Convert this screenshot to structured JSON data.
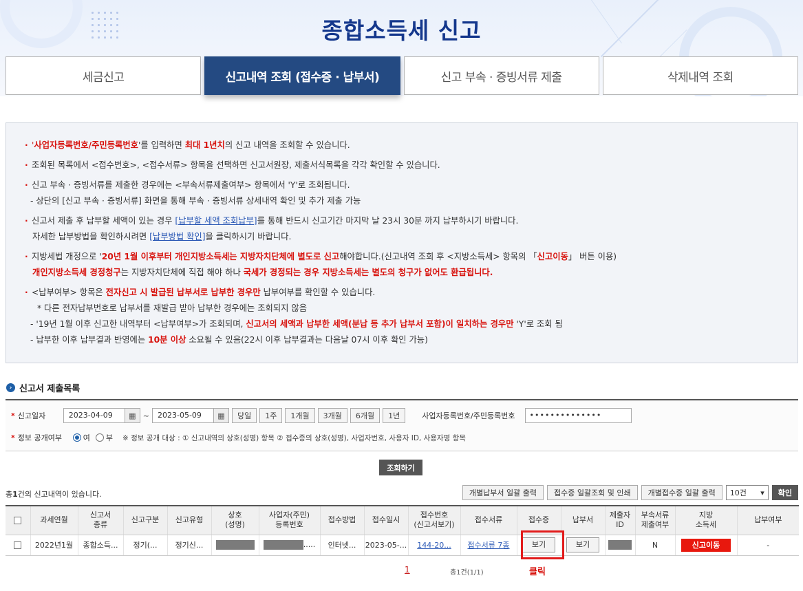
{
  "header": {
    "title": "종합소득세  신고"
  },
  "tabs": [
    {
      "label": "세금신고"
    },
    {
      "label": "신고내역 조회 (접수증 · 납부서)"
    },
    {
      "label": "신고 부속 · 증빙서류 제출"
    },
    {
      "label": "삭제내역 조회"
    }
  ],
  "notice": {
    "l1a": "'",
    "l1b": "사업자등록번호/주민등록번호",
    "l1c": "'를 입력하면 ",
    "l1d": "최대 1년치",
    "l1e": "의 신고 내역을 조회할 수 있습니다.",
    "l2": "조회된 목록에서 <접수번호>, <접수서류> 항목을 선택하면 신고서원장, 제출서식목록을 각각 확인할 수 있습니다.",
    "l3": "신고 부속 · 증빙서류를 제출한 경우에는 <부속서류제출여부> 항목에서 'Y'로 조회됩니다.",
    "l4": "- 상단의 [신고 부속 · 증빙서류] 화면을 통해 부속 · 증빙서류 상세내역 확인 및 추가 제출 가능",
    "l5a": "신고서 제출 후 납부할 세액이 있는 경우 ",
    "l5b": "[납부할 세액 조회납부]",
    "l5c": "를 통해 반드시 신고기간 마지막 날 23시 30분 까지 납부하시기 바랍니다.",
    "l6a": "자세한 납부방법을 확인하시려면 ",
    "l6b": "[납부방법 확인]",
    "l6c": "을 클릭하시기 바랍니다.",
    "l7a": "지방세법 개정으로 '",
    "l7b": "20년 1월 이후부터 개인지방소득세는 지방자치단체에 별도로 신고",
    "l7c": "해야합니다.(신고내역 조회 후 <지방소득세> 항목의 「",
    "l7d": "신고이동",
    "l7e": "」 버튼 이용)",
    "l8a": "개인지방소득세 경정청구",
    "l8b": "는 지방자치단체에 직접 해야 하나 ",
    "l8c": "국세가 경정되는 경우 지방소득세는 별도의 청구가 없어도 환급됩니다.",
    "l9a": "<납부여부> 항목은 ",
    "l9b": "전자신고 시 발급된 납부서로 납부한 경우만",
    "l9c": " 납부여부를 확인할 수 있습니다.",
    "l10": "* 다른 전자납부번호로 납부서를 재발급 받아 납부한 경우에는 조회되지 않음",
    "l11a": "- '19년 1월 이후 신고한 내역부터 <납부여부>가 조회되며, ",
    "l11b": "신고서의 세액과 납부한 세액(분납 등 추가 납부서 포함)이 일치하는 경우만",
    "l11c": " 'Y'로 조회 됨",
    "l12a": "- 납부한 이후 납부결과 반영에는 ",
    "l12b": "10분 이상",
    "l12c": " 소요될 수 있음(22시 이후 납부결과는 다음날 07시 이후 확인 가능)"
  },
  "section": {
    "title": "신고서 제출목록"
  },
  "search": {
    "date_label": "신고일자",
    "date_from": "2023-04-09",
    "date_to": "2023-05-09",
    "periods": [
      "당일",
      "1주",
      "1개월",
      "3개월",
      "6개월",
      "1년"
    ],
    "biz_label": "사업자등록번호/주민등록번호",
    "biz_value": "••••••••••••••",
    "public_label": "정보 공개여부",
    "opt_yes": "여",
    "opt_no": "부",
    "note": "※ 정보 공개 대상 : ① 신고내역의 상호(성명) 항목 ② 접수증의 상호(성명), 사업자번호, 사용자 ID, 사용자명 항목",
    "inquire_label": "조회하기"
  },
  "toolbar": {
    "count_prefix": "총",
    "count_num": "1",
    "count_suffix": "건의 신고내역이 있습니다.",
    "btn_pay_print": "개별납부서 일괄 출력",
    "btn_receipt_print": "접수증 일괄조회 및 인쇄",
    "btn_receipt_each": "개별접수증 일괄 출력",
    "page_size": "10건",
    "ok": "확인"
  },
  "table": {
    "headers": [
      "",
      "과세연월",
      "신고서\n종류",
      "신고구분",
      "신고유형",
      "상호\n(성명)",
      "사업자(주민)\n등록번호",
      "접수방법",
      "접수일시",
      "접수번호\n(신고서보기)",
      "접수서류",
      "접수증",
      "납부서",
      "제출자\nID",
      "부속서류\n제출여부",
      "지방\n소득세",
      "납부여부"
    ],
    "row": {
      "period": "2022년1월",
      "type": "종합소득...",
      "div": "정기(...",
      "kind": "정기신...",
      "method": "인터넷...",
      "date": "2023-05-...",
      "receipt_no": "144-20...",
      "docs": "접수서류 7종",
      "receipt_btn": "보기",
      "bill_btn": "보기",
      "attach": "N",
      "local_btn": "신고이동",
      "paid": "-"
    }
  },
  "annotation": {
    "click": "클릭"
  },
  "pager": {
    "current": "1",
    "info": "총1건(1/1)"
  }
}
